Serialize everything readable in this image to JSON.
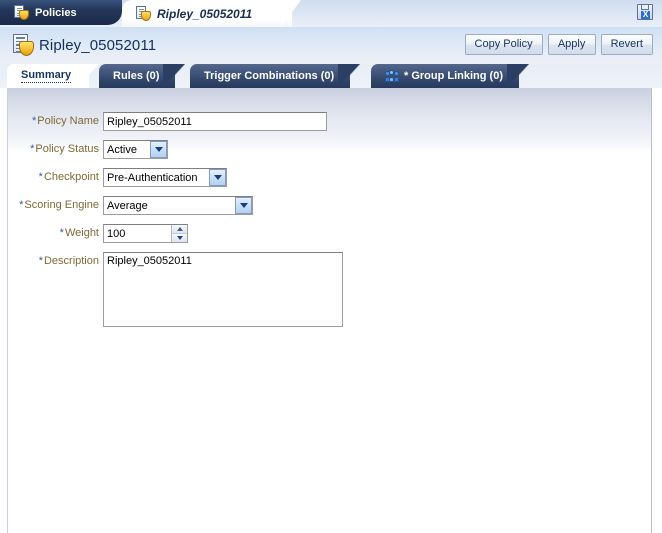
{
  "window_tabs": [
    {
      "label": "Policies",
      "icon": "document-shield-icon",
      "active": false
    },
    {
      "label": "Ripley_05052011",
      "icon": "document-shield-icon",
      "active": true
    }
  ],
  "toolbar": {
    "export_icon": "export-to-excel-icon"
  },
  "header": {
    "title": "Ripley_05052011",
    "title_icon": "policy-shield-icon",
    "buttons": [
      {
        "label": "Copy Policy"
      },
      {
        "label": "Apply"
      },
      {
        "label": "Revert"
      }
    ]
  },
  "subtabs": [
    {
      "label": "Summary",
      "active": true,
      "icon": null
    },
    {
      "label": "Rules (0)",
      "active": false,
      "icon": null
    },
    {
      "label": "Trigger Combinations (0)",
      "active": false,
      "icon": null
    },
    {
      "label": "* Group Linking (0)",
      "active": false,
      "icon": "group-people-icon"
    }
  ],
  "form": {
    "required_marker": "*",
    "fields": {
      "policy_name": {
        "label": "Policy Name",
        "value": "Ripley_05052011",
        "placeholder": ""
      },
      "policy_status": {
        "label": "Policy Status",
        "value": "Active"
      },
      "checkpoint": {
        "label": "Checkpoint",
        "value": "Pre-Authentication"
      },
      "scoring_engine": {
        "label": "Scoring Engine",
        "value": "Average"
      },
      "weight": {
        "label": "Weight",
        "value": "100"
      },
      "description": {
        "label": "Description",
        "value": "Ripley_05052011",
        "placeholder": ""
      }
    }
  },
  "colors": {
    "label_text": "#7d6a34",
    "required_asterisk": "#2f5fa8",
    "tab_active_text": "#16335f",
    "title_text": "#12305c",
    "dark_tab_bg": "#273a5e"
  }
}
